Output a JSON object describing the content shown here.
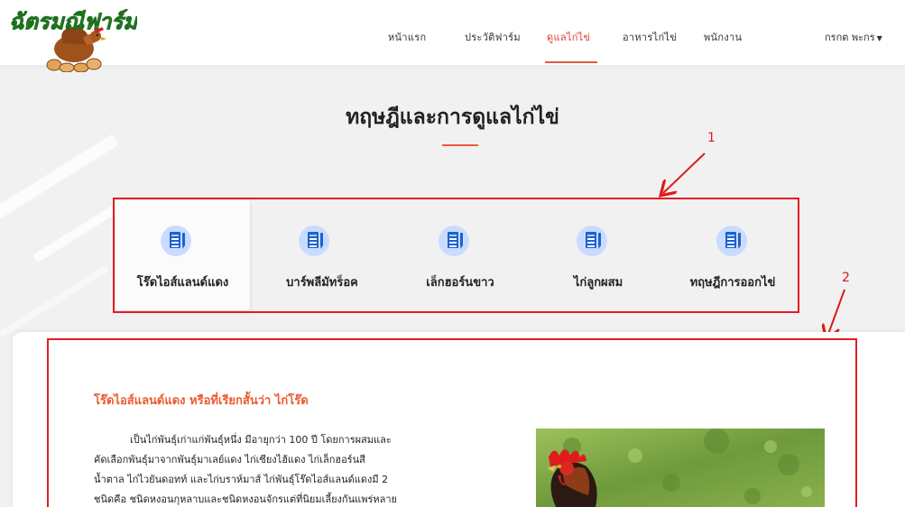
{
  "logo": {
    "text": "ฉัตรมณีฟาร์ม",
    "icon": "hen-on-eggs-logo"
  },
  "nav": {
    "items": [
      {
        "label": "หน้าแรก",
        "active": false
      },
      {
        "label": "ประวัติฟาร์ม",
        "active": false
      },
      {
        "label": "ดูแลไก่ไข่",
        "active": true
      },
      {
        "label": "อาหารไก่ไข่",
        "active": false
      },
      {
        "label": "พนักงาน",
        "active": false
      }
    ],
    "user": "กรกต พะกร",
    "user_caret_icon": "caret-down-icon"
  },
  "page": {
    "title": "ทฤษฎีและการดูแลไก่ไข่"
  },
  "cards": [
    {
      "label": "โร๊ดไอส์แลนด์แดง",
      "icon": "document-pen-icon",
      "selected": true
    },
    {
      "label": "บาร์พลีมัทร็อค",
      "icon": "document-pen-icon",
      "selected": false
    },
    {
      "label": "เล็กฮอร์นขาว",
      "icon": "document-pen-icon",
      "selected": false
    },
    {
      "label": "ไก่ลูกผสม",
      "icon": "document-pen-icon",
      "selected": false
    },
    {
      "label": "ทฤษฎีการออกไข่",
      "icon": "document-pen-icon",
      "selected": false
    }
  ],
  "annotations": {
    "one": "1",
    "two": "2"
  },
  "article": {
    "title": "โร๊ดไอส์แลนด์แดง หรือที่เรียกสั้นว่า ไก่โร๊ด",
    "lines": [
      "เป็นไก่พันธุ์เก่าแก่พันธุ์หนึ่ง มีอายุกว่า 100 ปี โดยการผสมและ",
      "คัดเลือกพันธุ์มาจากพันธุ์มาเลย์แดง ไก่เซียงไฮ้แดง ไก่เล็กฮอร์นสี",
      "น้ำตาล ไก่ไวยันดอทท์ และไก่บราห์มาส์ ไก่พันธุ์โร๊ดไอส์แลนด์แดงมี 2",
      "ชนิดคือ ชนิดหงอนกุหลาบและชนิดหงอนจักรแต่ที่นิยมเลี้ยงกันแพร่หลาย"
    ],
    "photo_icon": "rooster-photo"
  },
  "colors": {
    "accent": "#e8563f",
    "annotation": "#e31d24",
    "icon_bg": "#c9dcff",
    "icon_fg": "#1d62ce"
  }
}
